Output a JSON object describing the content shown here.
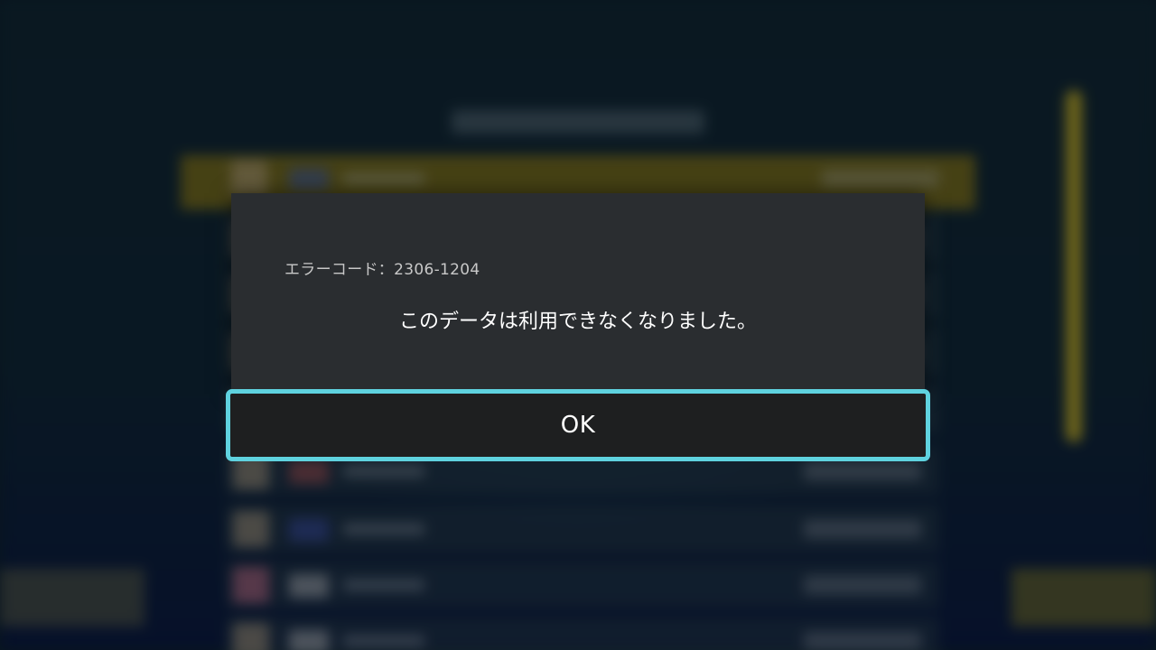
{
  "dialog": {
    "error_code": "エラーコード：2306-1204",
    "message": "このデータは利用できなくなりました。",
    "ok_label": "OK"
  },
  "colors": {
    "dialog_bg": "#2a2d30",
    "button_bg": "#1e1f20",
    "focus_border": "#5fd2df",
    "highlight_row": "#6b6420"
  }
}
